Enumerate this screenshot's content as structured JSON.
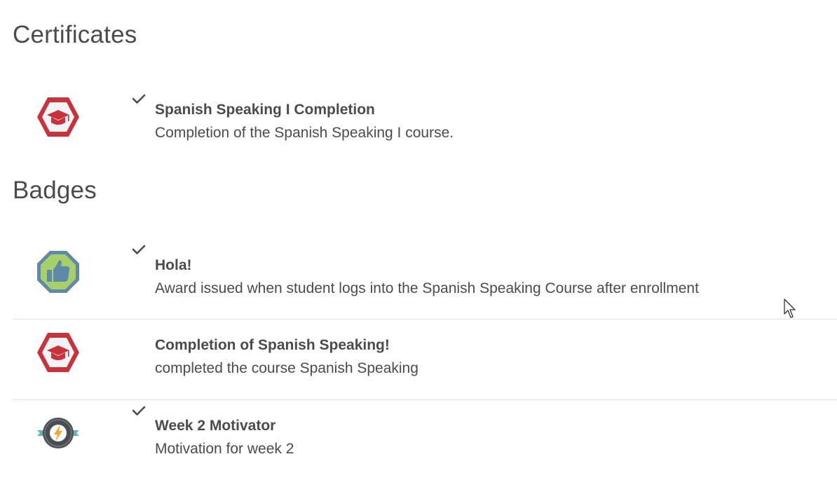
{
  "certificates": {
    "heading": "Certificates",
    "items": [
      {
        "name": "Spanish Speaking I Completion",
        "description": "Completion of the Spanish Speaking I course.",
        "earned": true,
        "icon": "graduation-cap-hexagon-icon"
      }
    ]
  },
  "badges": {
    "heading": "Badges",
    "items": [
      {
        "name": "Hola!",
        "description": "Award issued when student logs into the Spanish Speaking Course after enrollment",
        "earned": true,
        "icon": "thumbs-up-octagon-icon"
      },
      {
        "name": "Completion of Spanish Speaking!",
        "description": "completed the course Spanish Speaking",
        "earned": false,
        "icon": "graduation-cap-hexagon-icon"
      },
      {
        "name": "Week 2 Motivator",
        "description": "Motivation for week 2",
        "earned": true,
        "icon": "lightning-ribbon-badge-icon"
      }
    ]
  },
  "colors": {
    "text": "#494c4e",
    "divider": "#dfe1e3",
    "cert_red": "#c9313c",
    "badge_green": "#a8cf6a",
    "badge_blue": "#5d8aa8",
    "motivator_dark": "#4a4d52",
    "motivator_orange": "#f5a623",
    "ribbon_teal": "#5fb3b3"
  }
}
